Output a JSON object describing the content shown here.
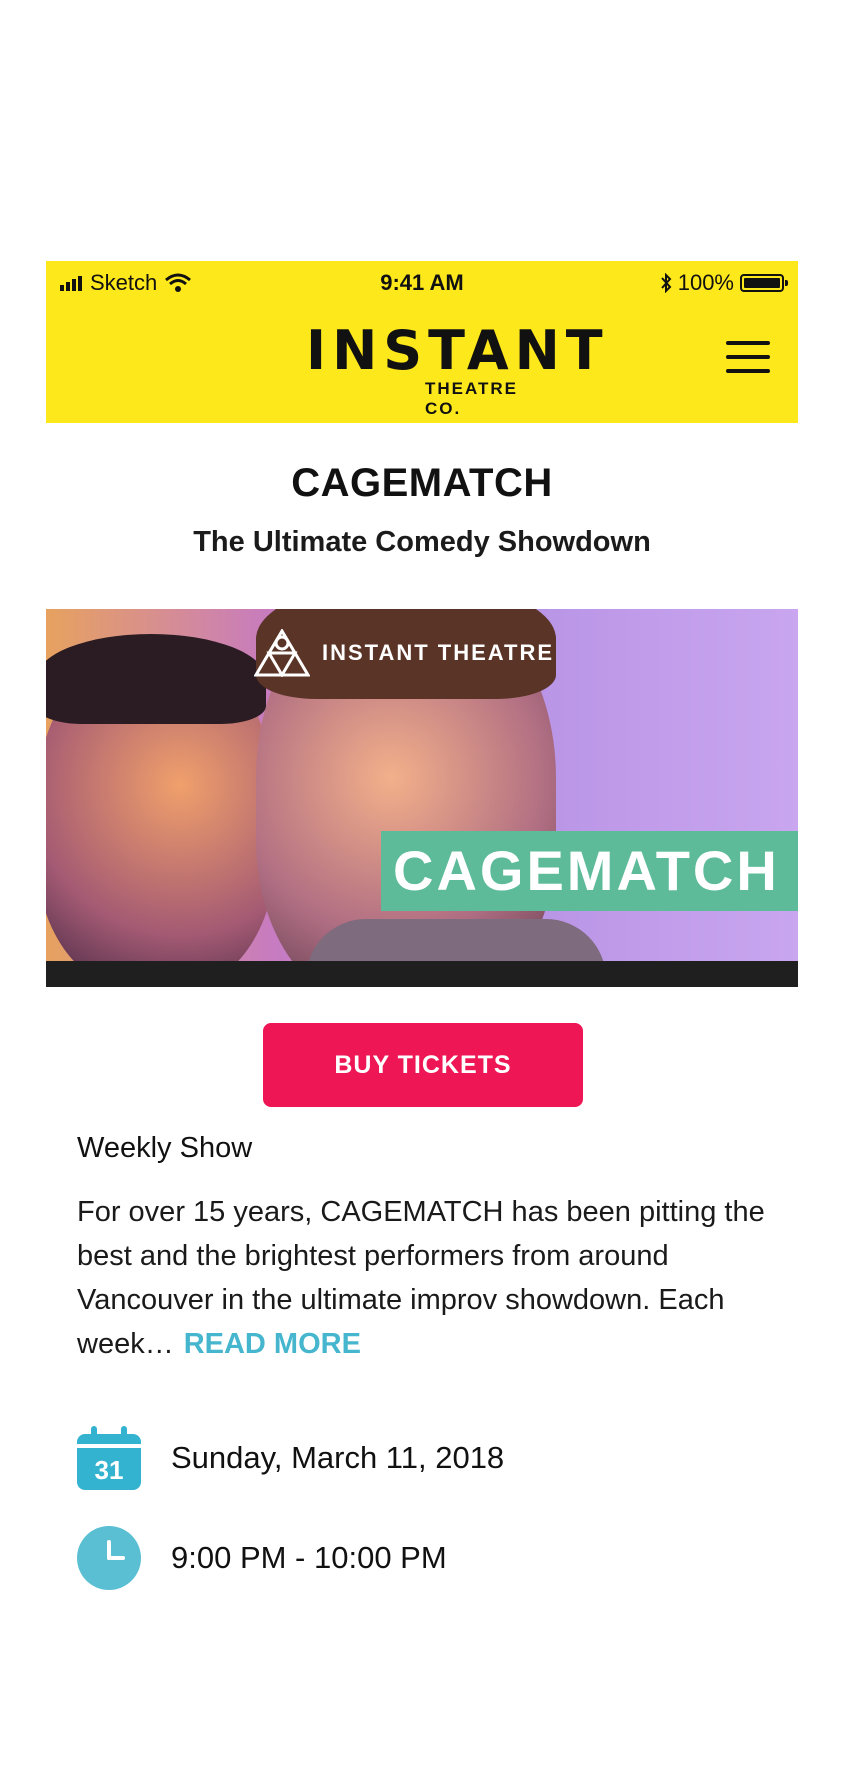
{
  "status_bar": {
    "carrier": "Sketch",
    "time": "9:41 AM",
    "battery": "100%"
  },
  "header": {
    "logo_main": "INSTANT",
    "logo_sub": "THEATRE CO."
  },
  "event": {
    "title": "CAGEMATCH",
    "subtitle": "The Ultimate Comedy Showdown",
    "hero_brand": "INSTANT THEATRE",
    "hero_tag": "CAGEMATCH",
    "buy_label": "BUY TICKETS",
    "type": "Weekly Show",
    "description": "For over 15 years, CAGEMATCH has been pitting the best and the brightest performers from around Vancouver in the ultimate improv showdown. Each week…",
    "read_more": "READ MORE",
    "calendar_day": "31",
    "date": "Sunday, March 11, 2018",
    "time": "9:00 PM - 10:00 PM"
  },
  "colors": {
    "header_bg": "#fde81c",
    "buy_button": "#ee1654",
    "accent": "#45b6ce",
    "tag_bg": "#5dbb9a"
  },
  "icons": [
    "signal-icon",
    "wifi-icon",
    "bluetooth-icon",
    "battery-icon",
    "menu-icon",
    "calendar-icon",
    "clock-icon"
  ]
}
